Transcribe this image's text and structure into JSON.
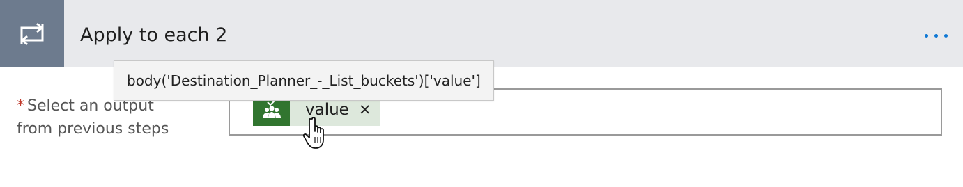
{
  "action": {
    "title": "Apply to each 2",
    "icon": "loop-icon",
    "menu_icon": "more-ellipsis-icon",
    "header_bg": "#e8e9ec",
    "icon_tile_bg": "#6d7b8e",
    "accent": "#0f78d4"
  },
  "field": {
    "required_marker": "*",
    "label_line1": "Select an output",
    "label_line2": "from previous steps",
    "token": {
      "text": "value",
      "remove_glyph": "✕",
      "icon": "planner-icon",
      "icon_bg": "#31752f",
      "bg": "#dde8dc"
    }
  },
  "tooltip": {
    "text": "body('Destination_Planner_-_List_buckets')['value']"
  }
}
